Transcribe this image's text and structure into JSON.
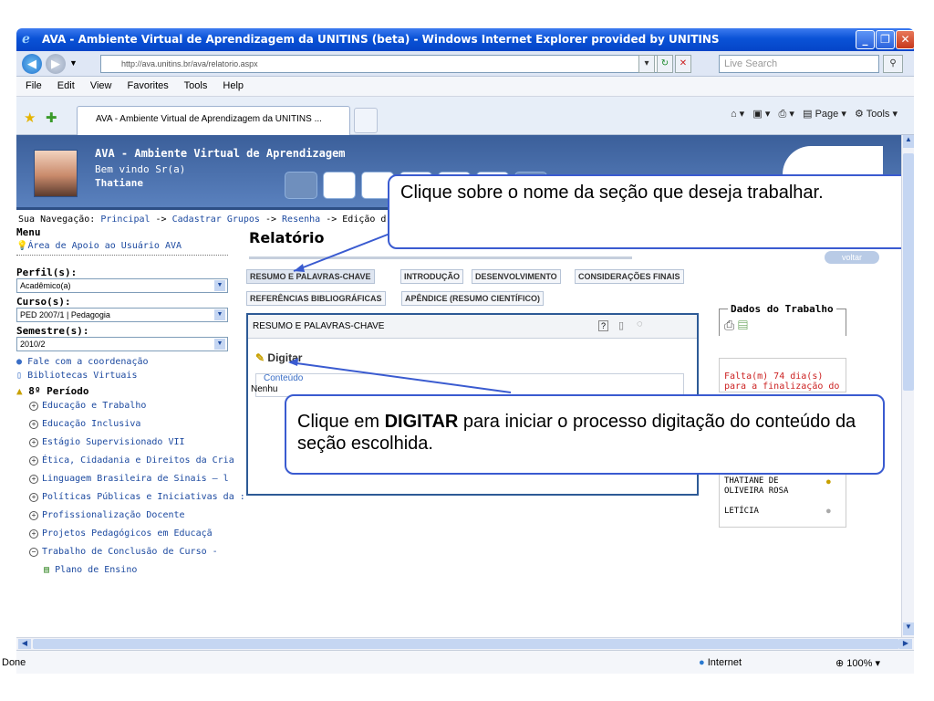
{
  "window": {
    "title": "AVA - Ambiente Virtual de Aprendizagem da UNITINS (beta) - Windows Internet Explorer provided by UNITINS"
  },
  "browser": {
    "url": "http://ava.unitins.br/ava/relatorio.aspx",
    "search_placeholder": "Live Search",
    "menu": [
      "File",
      "Edit",
      "View",
      "Favorites",
      "Tools",
      "Help"
    ],
    "tab_title": "AVA - Ambiente Virtual de Aprendizagem da UNITINS ...",
    "cmd": {
      "page": "Page",
      "tools": "Tools"
    }
  },
  "banner": {
    "title": "AVA - Ambiente Virtual de Aprendizagem",
    "welcome": "Bem vindo Sr(a)",
    "user": "Thatiane"
  },
  "breadcrumb": {
    "label": "Sua Navegação:",
    "path": [
      "Principal",
      "Cadastrar Grupos",
      "Resenha"
    ],
    "current": "Edição d"
  },
  "sidebar": {
    "menu_label": "Menu",
    "help_link": "Área de Apoio ao Usuário AVA",
    "perfil_label": "Perfil(s):",
    "perfil_value": "Acadêmico(a)",
    "curso_label": "Curso(s):",
    "curso_value": "PED 2007/1 | Pedagogia",
    "semestre_label": "Semestre(s):",
    "semestre_value": "2010/2",
    "fale": "Fale com a coordenação",
    "bibliotecas": "Bibliotecas Virtuais",
    "periodo": "8º Período",
    "courses": [
      "Educação e Trabalho",
      "Educação Inclusiva",
      "Estágio Supervisionado VII",
      "Ética, Cidadania e Direitos da Cria",
      "Linguagem Brasileira de Sinais – l",
      "Políticas Públicas e Iniciativas da :",
      "Profissionalização Docente",
      "Projetos Pedagógicos em Educaçã",
      "Trabalho de Conclusão de Curso -"
    ],
    "plano": "Plano de Ensino"
  },
  "main": {
    "title": "Relatório",
    "voltar": "voltar",
    "tabs": [
      "RESUMO E PALAVRAS-CHAVE",
      "INTRODUÇÃO",
      "DESENVOLVIMENTO",
      "CONSIDERAÇÕES FINAIS",
      "REFERÊNCIAS BIBLIOGRÁFICAS",
      "APÊNDICE (RESUMO CIENTÍFICO)"
    ],
    "section_header": "RESUMO E PALAVRAS-CHAVE",
    "digitar": "Digitar",
    "conteudo_label": "Conteúdo",
    "conteudo_value": "Nenhu"
  },
  "dados": {
    "title": "Dados do Trabalho",
    "alert": "Falta(m) 74 dia(s) para a finalização do",
    "members": [
      "THATIANE DE OLIVEIRA ROSA",
      "LETÍCIA"
    ]
  },
  "callouts": {
    "top": "Clique sobre o nome da seção que deseja trabalhar.",
    "bottom_pre": "Clique em ",
    "bottom_bold": "DIGITAR",
    "bottom_post": " para iniciar o processo digitação do conteúdo da seção escolhida."
  },
  "status": {
    "left": "Done",
    "zone": "Internet",
    "zoom": "100%"
  }
}
